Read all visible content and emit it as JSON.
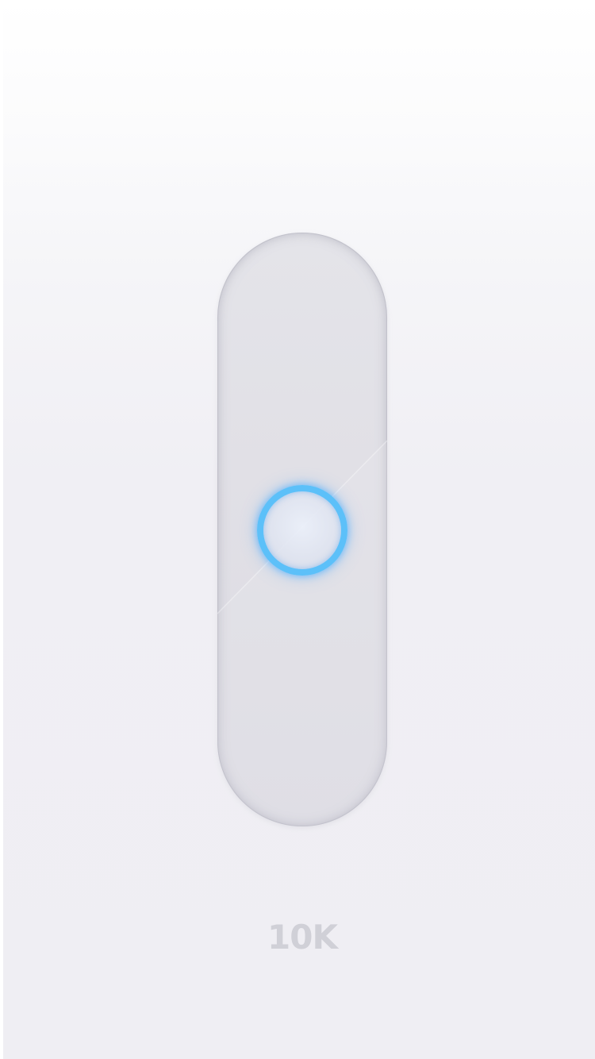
{
  "slider": {
    "value_label": "10K",
    "orientation": "vertical",
    "position_fraction": 0.5
  },
  "colors": {
    "background": "#efeef3",
    "track": "#dfdee5",
    "knob_ring": "#5cc0f9",
    "label": "#d0d0d7"
  }
}
